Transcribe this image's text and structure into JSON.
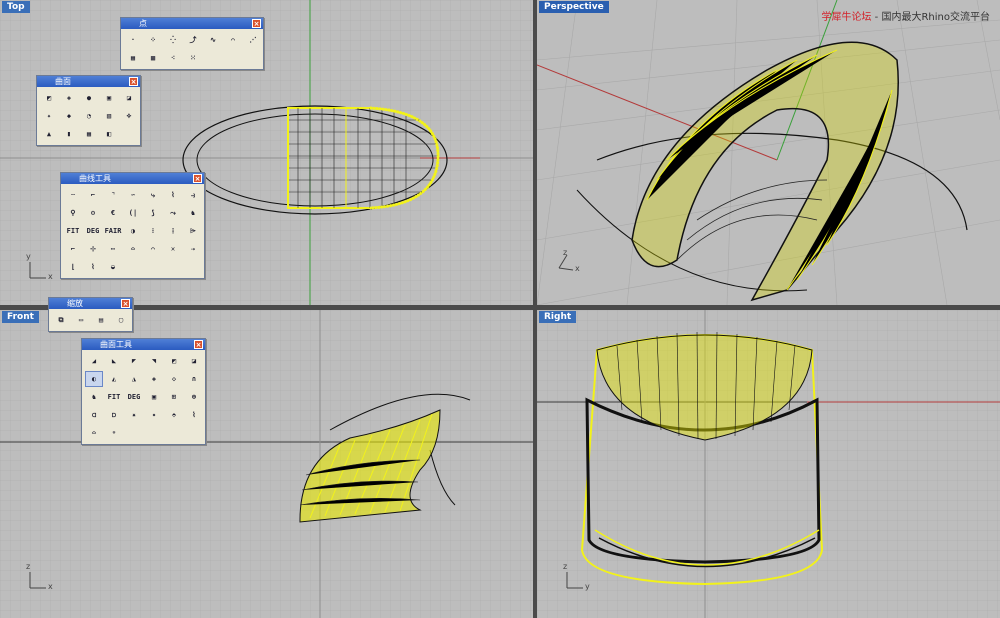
{
  "viewports": {
    "top": {
      "label": "Top"
    },
    "perspective": {
      "label": "Perspective"
    },
    "front": {
      "label": "Front"
    },
    "right": {
      "label": "Right"
    }
  },
  "axis_labels": {
    "x": "x",
    "y": "y",
    "z": "z"
  },
  "watermark": {
    "brand": "学犀牛论坛",
    "separator": " - ",
    "tagline": "国内最大Rhino交流平台"
  },
  "toolbars": {
    "points": {
      "title": "点",
      "close": "×"
    },
    "surface": {
      "title": "曲面",
      "close": "×"
    },
    "curve_tools": {
      "title": "曲线工具",
      "close": "×",
      "labels": {
        "fit": "FIT",
        "deg": "DEG",
        "fair": "FAIR"
      }
    },
    "zoom": {
      "title": "缩放",
      "close": "×"
    },
    "surface_tools": {
      "title": "曲面工具",
      "close": "×",
      "labels": {
        "fit": "FIT",
        "deg": "DEG"
      }
    }
  },
  "colors": {
    "viewport_bg": "#bdbdbd",
    "grid_minor": "#a9a9a9",
    "grid_major": "#8e8e8e",
    "x_axis": "#b33a3a",
    "y_axis": "#3aa03a",
    "wire": "#f2f21a",
    "mesh": "#000000",
    "label_bg": "#3a6fb8"
  }
}
